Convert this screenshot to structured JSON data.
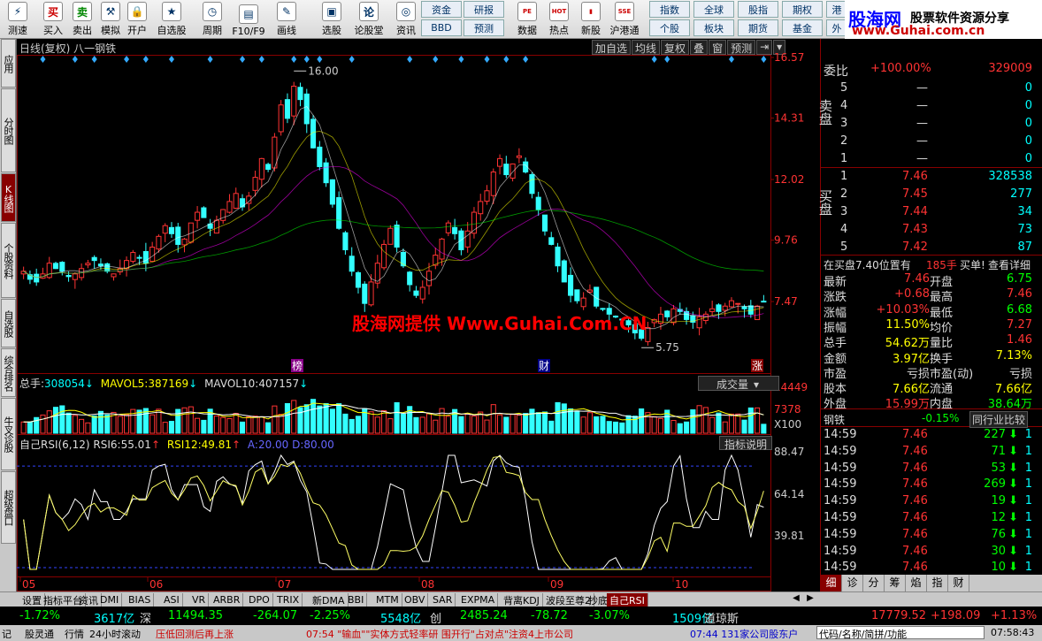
{
  "toolbar": {
    "buttons": [
      {
        "label": "测速",
        "icon": "speed-icon",
        "glyph": "⚡"
      },
      {
        "label": "买入",
        "icon": "buy-icon",
        "glyph": "买"
      },
      {
        "label": "卖出",
        "icon": "sell-icon",
        "glyph": "卖"
      },
      {
        "label": "模拟",
        "icon": "simulate-icon",
        "glyph": "⚒"
      },
      {
        "label": "开户",
        "icon": "lock-icon",
        "glyph": "🔒"
      },
      {
        "label": "自选股",
        "icon": "watchlist-icon",
        "glyph": "★"
      },
      {
        "label": "周期",
        "icon": "clock-icon",
        "glyph": "◷"
      },
      {
        "label": "F10/F9",
        "icon": "f10-icon",
        "glyph": "▤"
      },
      {
        "label": "画线",
        "icon": "pen-icon",
        "glyph": "✎"
      },
      {
        "label": "选股",
        "icon": "screen-icon",
        "glyph": "▣"
      },
      {
        "label": "论股堂",
        "icon": "forum-icon",
        "glyph": "论"
      },
      {
        "label": "资讯",
        "icon": "news-icon",
        "glyph": "◎"
      }
    ],
    "small": [
      {
        "label": "资金"
      },
      {
        "label": "研报"
      },
      {
        "label": "BBD"
      },
      {
        "label": "预测"
      }
    ],
    "buttons2": [
      {
        "label": "数据",
        "icon": "pe-icon",
        "glyph": "PE"
      },
      {
        "label": "热点",
        "icon": "hot-icon",
        "glyph": "HOT"
      },
      {
        "label": "新股",
        "icon": "newstock-icon",
        "glyph": "▮"
      },
      {
        "label": "沪港通",
        "icon": "hk-icon",
        "glyph": "SSE"
      }
    ],
    "small2": [
      {
        "label": "指数"
      },
      {
        "label": "全球"
      },
      {
        "label": "股指"
      },
      {
        "label": "期权"
      },
      {
        "label": "港"
      },
      {
        "label": "个股"
      },
      {
        "label": "板块"
      },
      {
        "label": "期货"
      },
      {
        "label": "基金"
      },
      {
        "label": "外"
      }
    ]
  },
  "brand": {
    "name": "股海网",
    "slogan": "股票软件资源分享",
    "url": "www.Guhai.com.cn"
  },
  "left_tabs": [
    "应用",
    "分时图",
    "K线图",
    "个股资料",
    "自选股",
    "综合排名",
    "牛叉诊股",
    "超级盘口"
  ],
  "chart": {
    "title": "日线(复权)  八一钢铁",
    "controls": [
      "加自选",
      "均线",
      "复权",
      "叠",
      "窗",
      "预测"
    ],
    "price_axis": [
      "16.57",
      "14.31",
      "12.02",
      "9.76",
      "7.47"
    ],
    "high_label": "16.00",
    "low_label": "5.75",
    "markers": [
      "榜",
      "财",
      "涨"
    ],
    "vol_header": {
      "name": "总手:",
      "v": "308054",
      "ma5_label": "MAVOL5:",
      "ma5": "387169",
      "ma10_label": "MAVOL10:",
      "ma10": "407157"
    },
    "vol_axis": [
      "14449",
      "7378",
      "X100"
    ],
    "vol_button": "成交量",
    "rsi_header": {
      "name": "自己RSI(6,12)",
      "rsi6_label": "RSI6:",
      "rsi6": "55.01",
      "rsi12_label": "RSI12:",
      "rsi12": "49.81",
      "a_label": "A:",
      "a": "20.00",
      "d_label": "D:",
      "d": "80.00"
    },
    "rsi_axis": [
      "88.47",
      "64.14",
      "39.81"
    ],
    "rsi_button": "指标说明",
    "months": [
      "05",
      "06",
      "07",
      "08",
      "09",
      "10"
    ],
    "colors": {
      "up": "#ff3333",
      "down": "#33ffff",
      "ma": "#ffffff",
      "rsi6": "#ffff66",
      "rsi12": "#ffffff",
      "guide": "#3344ff"
    }
  },
  "chart_data": {
    "type": "candlestick",
    "title": "日线(复权) 八一钢铁",
    "ylim": [
      5.0,
      16.57
    ],
    "note_high": 16.0,
    "note_low": 5.75,
    "close": [
      8.6,
      8.3,
      8.2,
      8.5,
      8.9,
      8.7,
      8.6,
      8.4,
      8.5,
      8.7,
      8.9,
      9.0,
      8.8,
      8.6,
      8.5,
      8.7,
      9.0,
      9.3,
      9.1,
      8.9,
      9.5,
      9.9,
      10.3,
      10.0,
      9.6,
      9.8,
      10.4,
      10.8,
      10.6,
      10.2,
      10.5,
      10.9,
      11.2,
      11.5,
      11.0,
      11.4,
      12.1,
      12.8,
      12.4,
      13.6,
      14.8,
      14.3,
      15.5,
      15.0,
      14.1,
      13.2,
      12.5,
      11.9,
      11.1,
      10.2,
      9.4,
      8.6,
      8.0,
      7.4,
      8.2,
      8.9,
      9.6,
      10.2,
      9.5,
      8.8,
      8.1,
      7.7,
      8.0,
      8.6,
      9.2,
      9.8,
      10.4,
      10.0,
      9.4,
      10.1,
      10.8,
      11.2,
      11.6,
      12.3,
      12.8,
      12.2,
      12.6,
      12.9,
      12.3,
      11.5,
      10.9,
      10.1,
      9.6,
      8.8,
      8.2,
      7.7,
      7.5,
      7.6,
      7.9,
      7.3,
      7.2,
      7.0,
      6.9,
      6.8,
      6.6,
      6.3,
      6.1,
      6.5,
      6.8,
      7.0,
      6.9,
      7.2,
      7.1,
      6.8,
      6.7,
      6.9,
      7.0,
      7.2,
      7.1,
      7.3,
      7.5,
      7.4,
      7.2,
      7.0,
      7.3,
      7.46
    ],
    "volume_range": [
      0,
      14449
    ],
    "rsi_range": [
      20,
      88.47
    ]
  },
  "quote": {
    "weibi_label": "委比",
    "weibi": "+100.00%",
    "weicha": "329009",
    "sell_label": "卖盘",
    "buy_label": "买盘",
    "sells": [
      {
        "n": "5",
        "p": "—",
        "v": "0"
      },
      {
        "n": "4",
        "p": "—",
        "v": "0"
      },
      {
        "n": "3",
        "p": "—",
        "v": "0"
      },
      {
        "n": "2",
        "p": "—",
        "v": "0"
      },
      {
        "n": "1",
        "p": "—",
        "v": "0"
      }
    ],
    "buys": [
      {
        "n": "1",
        "p": "7.46",
        "v": "328538"
      },
      {
        "n": "2",
        "p": "7.45",
        "v": "277"
      },
      {
        "n": "3",
        "p": "7.44",
        "v": "34"
      },
      {
        "n": "4",
        "p": "7.43",
        "v": "73"
      },
      {
        "n": "5",
        "p": "7.42",
        "v": "87"
      }
    ],
    "notice_a": "在买盘7.40位置有",
    "notice_b": "185手",
    "notice_c": "买单!",
    "notice_d": "查看详细",
    "stats": [
      {
        "l1": "最新",
        "v1": "7.46",
        "c1": "red",
        "l2": "开盘",
        "v2": "6.75",
        "c2": "green"
      },
      {
        "l1": "涨跌",
        "v1": "+0.68",
        "c1": "red",
        "l2": "最高",
        "v2": "7.46",
        "c2": "red"
      },
      {
        "l1": "涨幅",
        "v1": "+10.03%",
        "c1": "red",
        "l2": "最低",
        "v2": "6.68",
        "c2": "green"
      },
      {
        "l1": "振幅",
        "v1": "11.50%",
        "c1": "yellow",
        "l2": "均价",
        "v2": "7.27",
        "c2": "red"
      },
      {
        "l1": "总手",
        "v1": "54.62万",
        "c1": "yellow",
        "l2": "量比",
        "v2": "1.46",
        "c2": "red"
      },
      {
        "l1": "金额",
        "v1": "3.97亿",
        "c1": "yellow",
        "l2": "换手",
        "v2": "7.13%",
        "c2": "yellow"
      },
      {
        "l1": "市盈",
        "v1": "亏损",
        "c1": "white",
        "l2": "市盈(动)",
        "v2": "亏损",
        "c2": "white"
      },
      {
        "l1": "股本",
        "v1": "7.66亿",
        "c1": "yellow",
        "l2": "流通",
        "v2": "7.66亿",
        "c2": "yellow"
      },
      {
        "l1": "外盘",
        "v1": "15.99万",
        "c1": "red",
        "l2": "内盘",
        "v2": "38.64万",
        "c2": "green"
      }
    ],
    "industry": "钢铁",
    "industry_chg": "-0.15%",
    "industry_btn": "同行业比较",
    "ticks": [
      {
        "t": "14:59",
        "p": "7.46",
        "v": "227",
        "n": "1"
      },
      {
        "t": "14:59",
        "p": "7.46",
        "v": "71",
        "n": "1"
      },
      {
        "t": "14:59",
        "p": "7.46",
        "v": "53",
        "n": "1"
      },
      {
        "t": "14:59",
        "p": "7.46",
        "v": "269",
        "n": "1"
      },
      {
        "t": "14:59",
        "p": "7.46",
        "v": "19",
        "n": "1"
      },
      {
        "t": "14:59",
        "p": "7.46",
        "v": "12",
        "n": "1"
      },
      {
        "t": "14:59",
        "p": "7.46",
        "v": "76",
        "n": "1"
      },
      {
        "t": "14:59",
        "p": "7.46",
        "v": "30",
        "n": "1"
      },
      {
        "t": "14:59",
        "p": "7.46",
        "v": "10",
        "n": "1"
      },
      {
        "t": "15:00",
        "p": "7.46",
        "v": "34",
        "n": "1"
      }
    ],
    "sub_tabs": [
      "细",
      "诊",
      "分",
      "筹",
      "焰",
      "指",
      "财"
    ]
  },
  "bottom_tabs": [
    "设置",
    "指标平台",
    "资讯",
    "DMI",
    "BIAS",
    "ASI",
    "VR",
    "ARBR",
    "DPO",
    "TRIX",
    "新DMA",
    "BBI",
    "MTM",
    "OBV",
    "SAR",
    "EXPMA",
    "背离KDJ",
    "波段至尊2",
    "抄底",
    "自己RSI"
  ],
  "ticker": [
    {
      "t": "-1.72%",
      "c": "green"
    },
    {
      "t": "3617亿",
      "c": "cyan"
    },
    {
      "t": "深",
      "c": "white"
    },
    {
      "t": "11494.35",
      "c": "green"
    },
    {
      "t": "-264.07",
      "c": "green"
    },
    {
      "t": "-2.25%",
      "c": "green"
    },
    {
      "t": "5548亿",
      "c": "cyan"
    },
    {
      "t": "创",
      "c": "white"
    },
    {
      "t": "2485.24",
      "c": "green"
    },
    {
      "t": "-78.72",
      "c": "green"
    },
    {
      "t": "-3.07%",
      "c": "green"
    },
    {
      "t": "1509亿",
      "c": "cyan"
    },
    {
      "t": "道琼斯",
      "c": "white"
    },
    {
      "t": "17779.52",
      "c": "red"
    },
    {
      "t": "+198.09",
      "c": "red"
    },
    {
      "t": "+1.13%",
      "c": "red"
    }
  ],
  "status": {
    "a": "记",
    "b": "股灵通",
    "c": "行情",
    "d": "24小时滚动",
    "e": "压低回测后再上涨",
    "f": "07:54 \"输血\"\"实体方式轻率研 围开行\"占对点\"注资4上市公司",
    "g": "07:44 131家公司股东户",
    "h": "代码/名称/简拼/功能",
    "i": "07:58:43"
  },
  "watermark": "股海网提供 Www.Guhai.Com.CN"
}
